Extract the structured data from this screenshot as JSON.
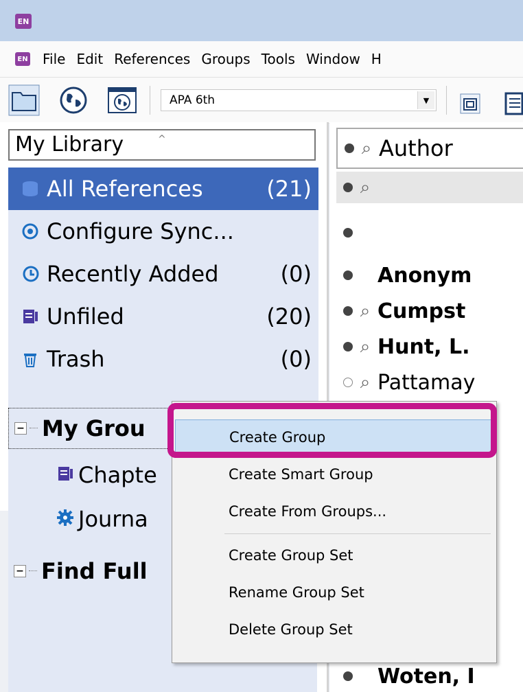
{
  "app": {
    "icon_text": "EN"
  },
  "menubar": {
    "icon_text": "EN",
    "items": [
      "File",
      "Edit",
      "References",
      "Groups",
      "Tools",
      "Window",
      "H"
    ]
  },
  "toolbar": {
    "style_value": "APA 6th"
  },
  "library": {
    "header": "My Library",
    "items": [
      {
        "label": "All References",
        "count": "(21)",
        "selected": true,
        "icon": "database-icon"
      },
      {
        "label": "Configure Sync...",
        "count": "",
        "icon": "sync-icon"
      },
      {
        "label": "Recently Added",
        "count": "(0)",
        "icon": "history-icon"
      },
      {
        "label": "Unfiled",
        "count": "(20)",
        "icon": "unfiled-icon"
      },
      {
        "label": "Trash",
        "count": "(0)",
        "icon": "trash-icon"
      }
    ]
  },
  "groups": {
    "my_groups": "My Grou",
    "items": [
      "Chapte",
      "Journa"
    ],
    "find_full": "Find Full"
  },
  "references": {
    "column_header": "Author",
    "rows": [
      {
        "author": "",
        "clip": true
      },
      {
        "author": "",
        "clip": false
      },
      {
        "author": "Anonym",
        "clip": false
      },
      {
        "author": "Cumpst",
        "clip": true
      },
      {
        "author": "Hunt, L.",
        "clip": true
      },
      {
        "author": "Pattamay",
        "clip": true
      },
      {
        "author": "Woten, I",
        "clip": false
      }
    ]
  },
  "context_menu": {
    "items": [
      "Create Group",
      "Create Smart Group",
      "Create From Groups...",
      "Create Group Set",
      "Rename Group Set",
      "Delete Group Set"
    ]
  },
  "colors": {
    "selection": "#3d68ba",
    "highlight": "#c4168c",
    "menu_hover": "#cde1f5"
  }
}
